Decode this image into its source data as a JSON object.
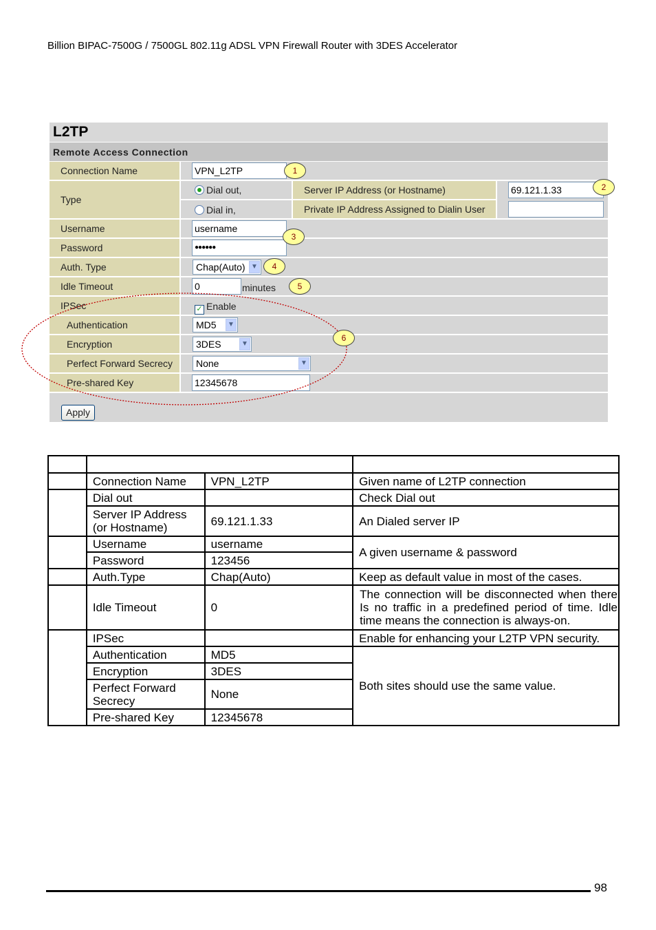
{
  "header": "Billion BIPAC-7500G / 7500GL 802.11g ADSL VPN Firewall Router with 3DES Accelerator",
  "form": {
    "title": "L2TP",
    "section": "Remote Access Connection",
    "connection_name_label": "Connection Name",
    "connection_name_value": "VPN_L2TP",
    "type_label": "Type",
    "dial_out": "Dial out,",
    "dial_in": "Dial in,",
    "selected_type": "Dial out",
    "server_ip_label": "Server IP Address (or Hostname)",
    "server_ip_value": "69.121.1.33",
    "private_ip_label": "Private IP Address Assigned to Dialin User",
    "private_ip_value": "",
    "username_label": "Username",
    "username_value": "username",
    "password_label": "Password",
    "password_value": "●●●●●●",
    "auth_type_label": "Auth. Type",
    "auth_type_value": "Chap(Auto)",
    "idle_timeout_label": "Idle Timeout",
    "idle_timeout_value": "0",
    "minutes": "minutes",
    "ipsec_label": "IPSec",
    "ipsec_enable": "Enable",
    "ipsec_checked": true,
    "authentication_label": "Authentication",
    "authentication_value": "MD5",
    "encryption_label": "Encryption",
    "encryption_value": "3DES",
    "pfs_label": "Perfect Forward Secrecy",
    "pfs_value": "None",
    "psk_label": "Pre-shared Key",
    "psk_value": "12345678",
    "apply": "Apply",
    "callouts": [
      "1",
      "2",
      "3",
      "4",
      "5",
      "6"
    ]
  },
  "table": {
    "rows": [
      {
        "param": "Connection Name",
        "value": "VPN_L2TP",
        "desc": "Given name of L2TP connection"
      },
      {
        "param": "Dial out",
        "value": "",
        "desc": "Check Dial out"
      },
      {
        "param": "Server IP Address (or Hostname)",
        "value": "69.121.1.33",
        "desc": "An Dialed server IP"
      },
      {
        "param": "Username",
        "value": "username",
        "desc": "A given username & password"
      },
      {
        "param": "Password",
        "value": "123456"
      },
      {
        "param": "Auth.Type",
        "value": "Chap(Auto)",
        "desc": "Keep as default value in most of the cases."
      },
      {
        "param": "Idle Timeout",
        "value": "0",
        "desc": "The connection will be disconnected when there Is no traffic in a predefined period of time. Idle time means the connection is always-on."
      },
      {
        "param": "IPSec",
        "value": "",
        "desc": "Enable for enhancing your L2TP VPN security."
      },
      {
        "param": "Authentication",
        "value": "MD5",
        "desc": "Both sites should use the same value."
      },
      {
        "param": "Encryption",
        "value": "3DES"
      },
      {
        "param": "Perfect Forward Secrecy",
        "value": "None"
      },
      {
        "param": "Pre-shared Key",
        "value": "12345678"
      }
    ]
  },
  "page_number": "98"
}
